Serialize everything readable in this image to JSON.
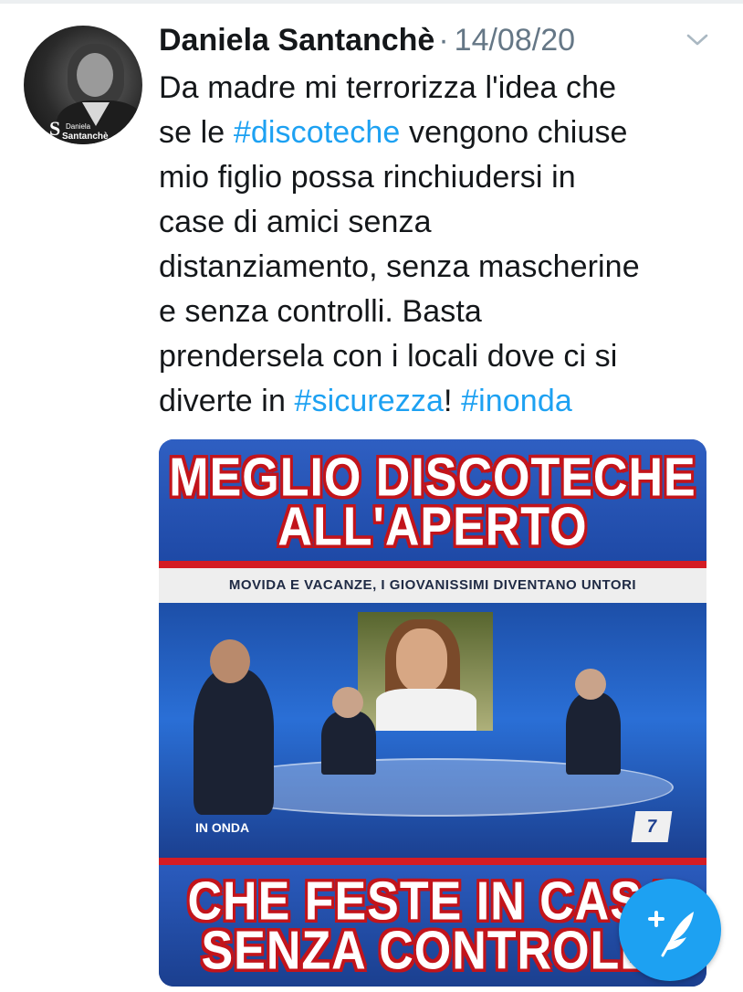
{
  "tweet": {
    "author_name": "Daniela Santanchè",
    "separator": "·",
    "date": "14/08/20",
    "avatar_brand_line1": "Daniela",
    "avatar_brand_line2": "Santanchè",
    "avatar_logo": "S",
    "text_lines": [
      [
        {
          "t": "Da madre mi terrorizza l'idea che"
        }
      ],
      [
        {
          "t": "se le "
        },
        {
          "t": "#discoteche",
          "tag": true
        },
        {
          "t": " vengono chiuse"
        }
      ],
      [
        {
          "t": "mio figlio possa rinchiudersi in"
        }
      ],
      [
        {
          "t": "case di amici senza"
        }
      ],
      [
        {
          "t": "distanziamento, senza mascherine"
        }
      ],
      [
        {
          "t": "e senza controlli. Basta"
        }
      ],
      [
        {
          "t": "prendersela con i locali dove ci si"
        }
      ],
      [
        {
          "t": "diverte in "
        },
        {
          "t": "#sicurezza",
          "tag": true
        },
        {
          "t": "! "
        },
        {
          "t": "#inonda",
          "tag": true
        }
      ]
    ]
  },
  "media": {
    "headline_top_1": "MEGLIO DISCOTECHE",
    "headline_top_2": "ALL'APERTO",
    "subtitle": "MOVIDA E VACANZE, I GIOVANISSIMI DIVENTANO UNTORI",
    "show_logo": "IN ONDA",
    "channel_logo": "7",
    "headline_bottom_1": "CHE FESTE IN CASA",
    "headline_bottom_2": "SENZA CONTROLLI"
  },
  "icons": {
    "menu": "chevron-down-icon",
    "compose": "compose-tweet-icon"
  },
  "colors": {
    "link": "#1da1f2",
    "muted": "#657786",
    "text": "#14171a",
    "banner_red": "#c2141b",
    "banner_blue": "#1e49a6"
  }
}
